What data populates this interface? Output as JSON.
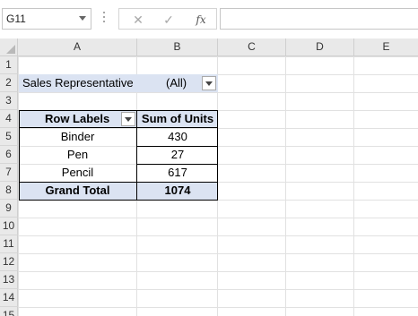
{
  "formula_bar": {
    "name_box": "G11",
    "cancel_icon": "✕",
    "enter_icon": "✓",
    "fx_label": "fx",
    "formula": ""
  },
  "columns": [
    "A",
    "B",
    "C",
    "D",
    "E"
  ],
  "rows": [
    "1",
    "2",
    "3",
    "4",
    "5",
    "6",
    "7",
    "8",
    "9",
    "10",
    "11",
    "12",
    "13",
    "14",
    "15"
  ],
  "pivot": {
    "filter_label": "Sales Representative",
    "filter_value": "(All)",
    "row_labels_header": "Row Labels",
    "values_header": "Sum of Units",
    "items": [
      {
        "label": "Binder",
        "value": "430"
      },
      {
        "label": "Pen",
        "value": "27"
      },
      {
        "label": "Pencil",
        "value": "617"
      }
    ],
    "grand_total_label": "Grand Total",
    "grand_total_value": "1074"
  },
  "colors": {
    "pivot_header_fill": "#dbe3f2",
    "header_bg": "#e9e9e9",
    "gridline": "#e1e1e1"
  }
}
